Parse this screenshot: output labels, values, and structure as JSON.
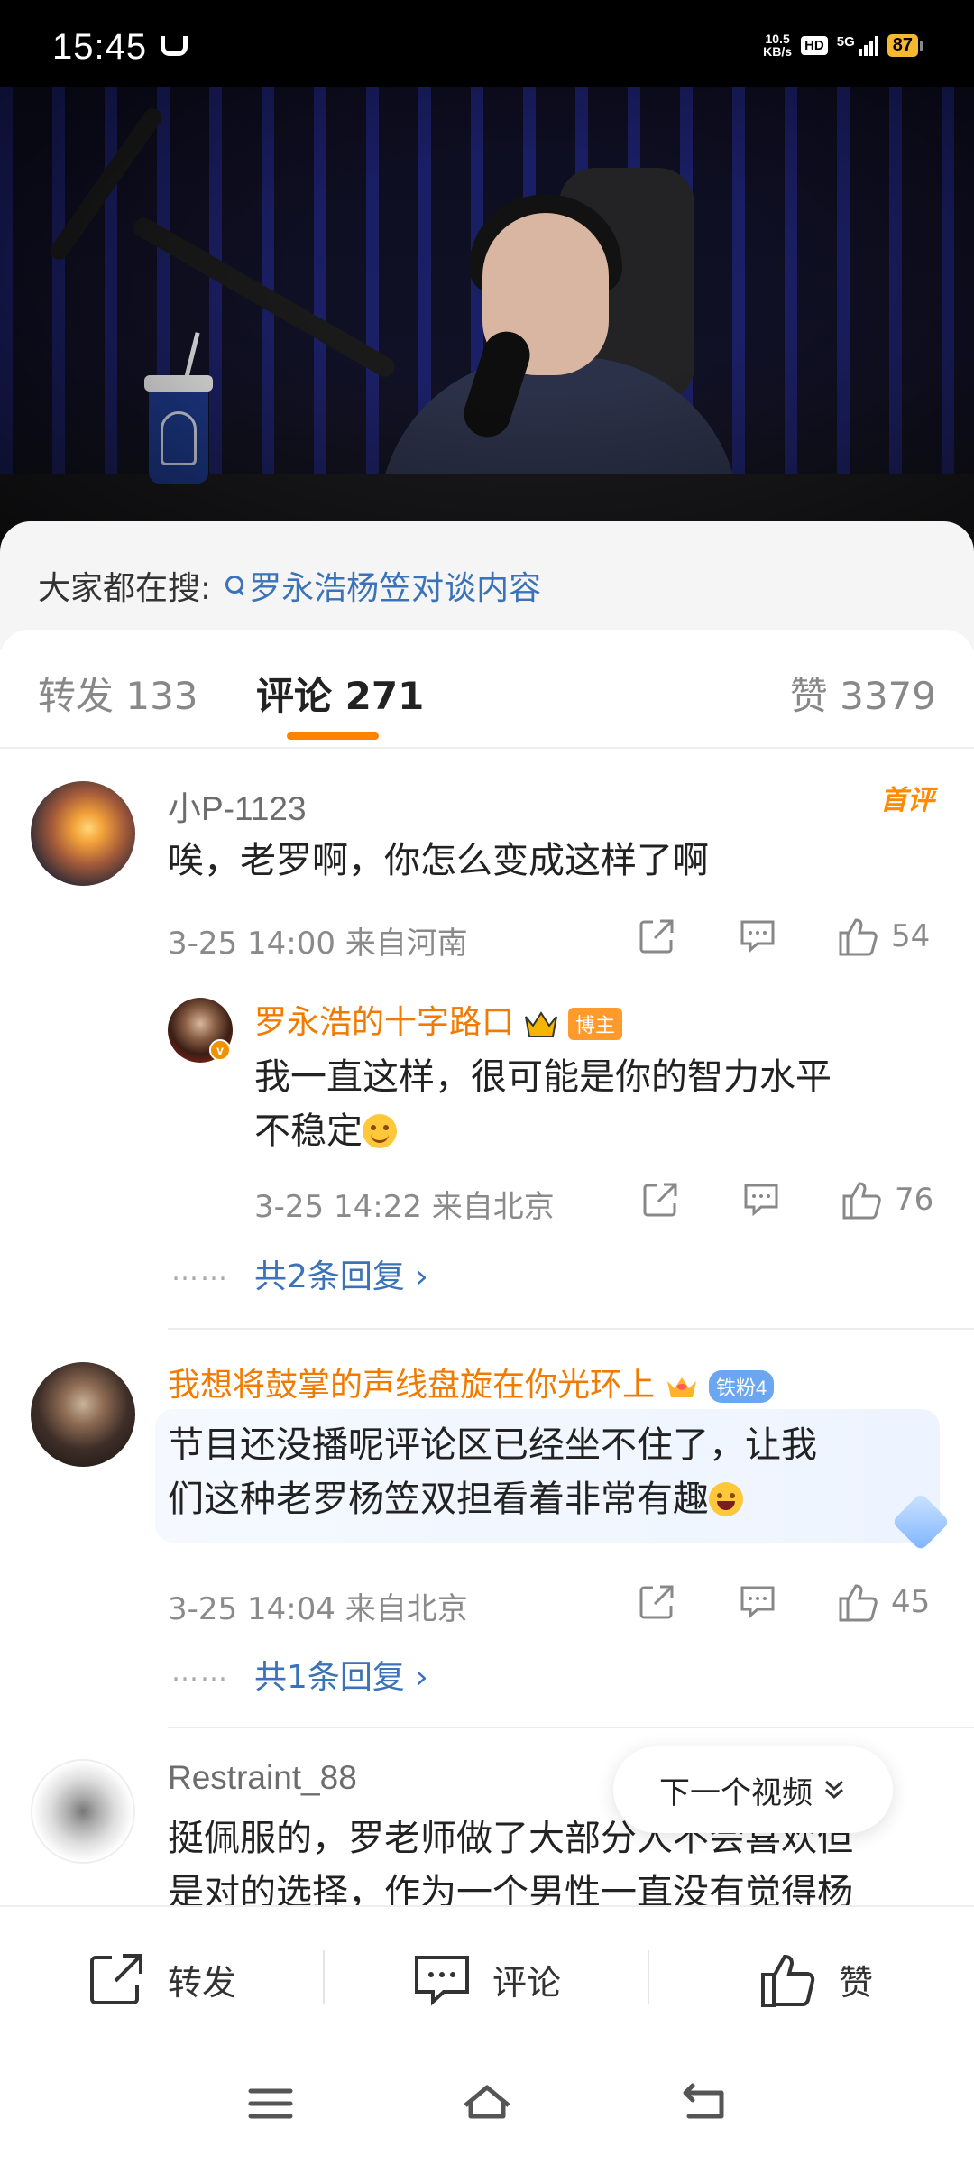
{
  "status_bar": {
    "time": "15:45",
    "net_speed_value": "10.5",
    "net_speed_unit": "KB/s",
    "hd_label": "HD",
    "network_label": "5G",
    "battery": "87"
  },
  "search_hint": {
    "label": "大家都在搜:",
    "query": "罗永浩杨笠对谈内容"
  },
  "tabs": {
    "repost": "转发 133",
    "comment": "评论 271",
    "like": "赞 3379"
  },
  "comments": [
    {
      "username": "小P-1123",
      "badge_first": "首评",
      "text": "唉，老罗啊，你怎么变成这样了啊",
      "meta": "3-25 14:00  来自河南",
      "likes": "54",
      "reply": {
        "username": "罗永浩的十字路口",
        "badge": "博主",
        "text_line1": "我一直这样，很可能是你的智力水平",
        "text_line2": "不稳定",
        "meta": "3-25 14:22  来自北京",
        "likes": "76"
      },
      "more_replies": "共2条回复 ›",
      "dots": "……"
    },
    {
      "username": "我想将鼓掌的声线盘旋在你光环上",
      "badge": "铁粉4",
      "text_line1": "节目还没播呢评论区已经坐不住了，让我",
      "text_line2": "们这种老罗杨笠双担看着非常有趣",
      "meta": "3-25 14:04  来自北京",
      "likes": "45",
      "more_replies": "共1条回复 ›",
      "dots": "……"
    },
    {
      "username": "Restraint_88",
      "text_line1": "挺佩服的，罗老师做了大部分人不会喜欢但",
      "text_line2": "是对的选择，作为一个男性一直没有觉得杨"
    }
  ],
  "next_video": "下一个视频",
  "bottom_bar": {
    "repost": "转发",
    "comment": "评论",
    "like": "赞"
  },
  "colors": {
    "accent_orange": "#ff8200",
    "link_blue": "#3b72b8",
    "username_orange": "#f07b00"
  }
}
